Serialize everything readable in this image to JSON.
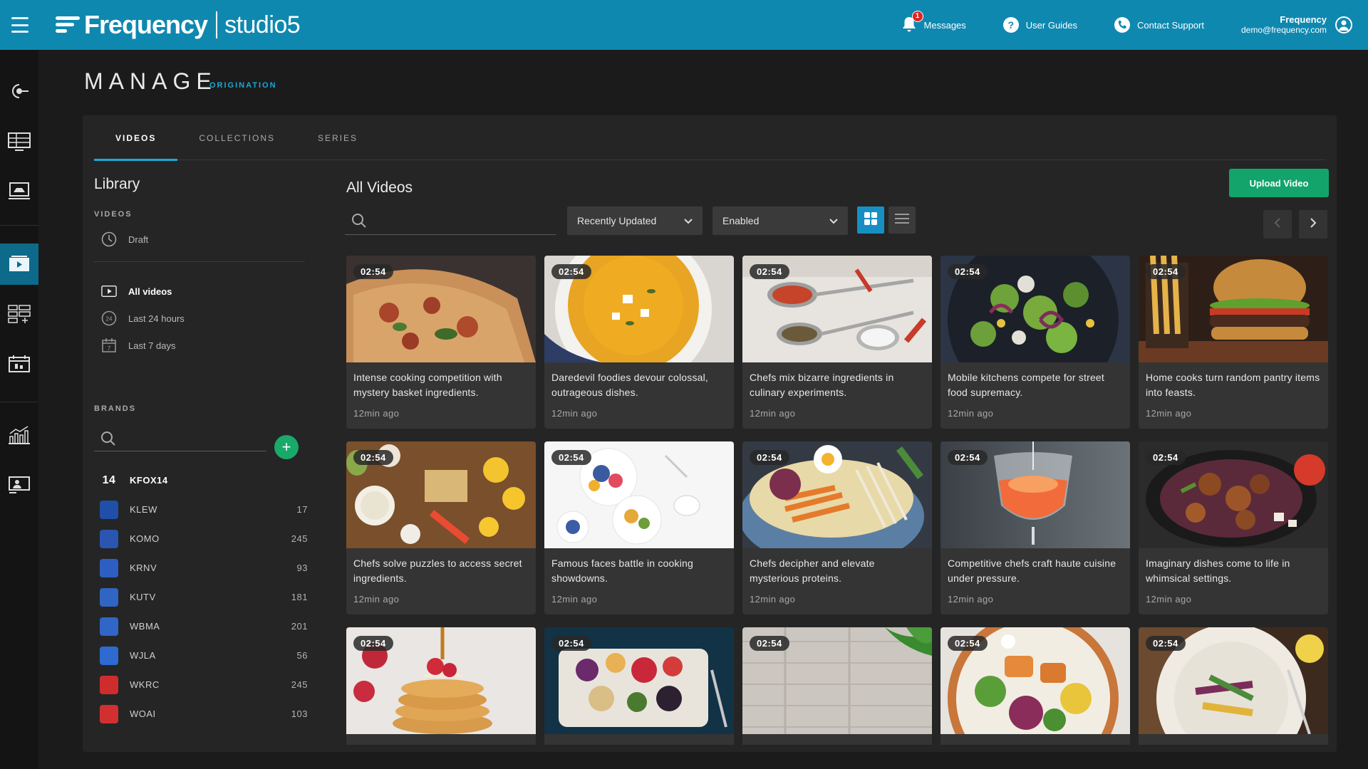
{
  "header": {
    "brand_name": "Frequency",
    "brand_product": "studio",
    "brand_version": "5",
    "messages_label": "Messages",
    "messages_count": "1",
    "guides_label": "User Guides",
    "support_label": "Contact Support",
    "user_name": "Frequency",
    "user_email": "demo@frequency.com"
  },
  "page": {
    "title": "MANAGE",
    "subtitle": "ORIGINATION"
  },
  "tabs": [
    {
      "label": "VIDEOS"
    },
    {
      "label": "COLLECTIONS"
    },
    {
      "label": "SERIES"
    }
  ],
  "library": {
    "title": "Library",
    "videos_label": "VIDEOS",
    "draft_label": "Draft",
    "all_videos_label": "All videos",
    "last24_label": "Last 24 hours",
    "last7_label": "Last 7 days",
    "brands_label": "BRANDS",
    "brand_search_placeholder": "",
    "brands": [
      {
        "name": "KFOX14",
        "count": "",
        "color": "#ffffff"
      },
      {
        "name": "KLEW",
        "count": "17",
        "color": "#1f4fa8"
      },
      {
        "name": "KOMO",
        "count": "245",
        "color": "#2a55b0"
      },
      {
        "name": "KRNV",
        "count": "93",
        "color": "#2d5fc2"
      },
      {
        "name": "KUTV",
        "count": "181",
        "color": "#3065c4"
      },
      {
        "name": "WBMA",
        "count": "201",
        "color": "#2f66c8"
      },
      {
        "name": "WJLA",
        "count": "56",
        "color": "#2e6ad0"
      },
      {
        "name": "WKRC",
        "count": "245",
        "color": "#cf2d2d"
      },
      {
        "name": "WOAI",
        "count": "103",
        "color": "#d23030"
      }
    ]
  },
  "content": {
    "title": "All Videos",
    "search_placeholder": "",
    "sort_value": "Recently Updated",
    "status_value": "Enabled",
    "upload_label": "Upload Video"
  },
  "videos": [
    {
      "duration": "02:54",
      "title": "Intense cooking competition with mystery basket ingredients.",
      "time": "12min ago",
      "thumb": "pizza"
    },
    {
      "duration": "02:54",
      "title": "Daredevil foodies devour colossal, outrageous dishes.",
      "time": "12min ago",
      "thumb": "soup"
    },
    {
      "duration": "02:54",
      "title": "Chefs mix bizarre ingredients in culinary experiments.",
      "time": "12min ago",
      "thumb": "spices"
    },
    {
      "duration": "02:54",
      "title": "Mobile kitchens compete for street food supremacy.",
      "time": "12min ago",
      "thumb": "salad"
    },
    {
      "duration": "02:54",
      "title": "Home cooks turn random pantry items into feasts.",
      "time": "12min ago",
      "thumb": "burger"
    },
    {
      "duration": "02:54",
      "title": "Chefs solve puzzles to access secret ingredients.",
      "time": "12min ago",
      "thumb": "board"
    },
    {
      "duration": "02:54",
      "title": "Famous faces battle in cooking showdowns.",
      "time": "12min ago",
      "thumb": "brunch"
    },
    {
      "duration": "02:54",
      "title": "Chefs decipher and elevate mysterious proteins.",
      "time": "12min ago",
      "thumb": "bowl"
    },
    {
      "duration": "02:54",
      "title": "Competitive chefs craft haute cuisine under pressure.",
      "time": "12min ago",
      "thumb": "drink"
    },
    {
      "duration": "02:54",
      "title": "Imaginary dishes come to life in whimsical settings.",
      "time": "12min ago",
      "thumb": "roast"
    },
    {
      "duration": "02:54",
      "title": "",
      "time": "",
      "thumb": "pancakes"
    },
    {
      "duration": "02:54",
      "title": "",
      "time": "",
      "thumb": "platter"
    },
    {
      "duration": "02:54",
      "title": "",
      "time": "",
      "thumb": "wood"
    },
    {
      "duration": "02:54",
      "title": "",
      "time": "",
      "thumb": "poke"
    },
    {
      "duration": "02:54",
      "title": "",
      "time": "",
      "thumb": "plate"
    }
  ],
  "colors": {
    "topbar": "#0f88b0",
    "accent": "#19a9d8",
    "upload": "#12a46a",
    "background": "#1b1b1b",
    "panel": "#252525"
  }
}
